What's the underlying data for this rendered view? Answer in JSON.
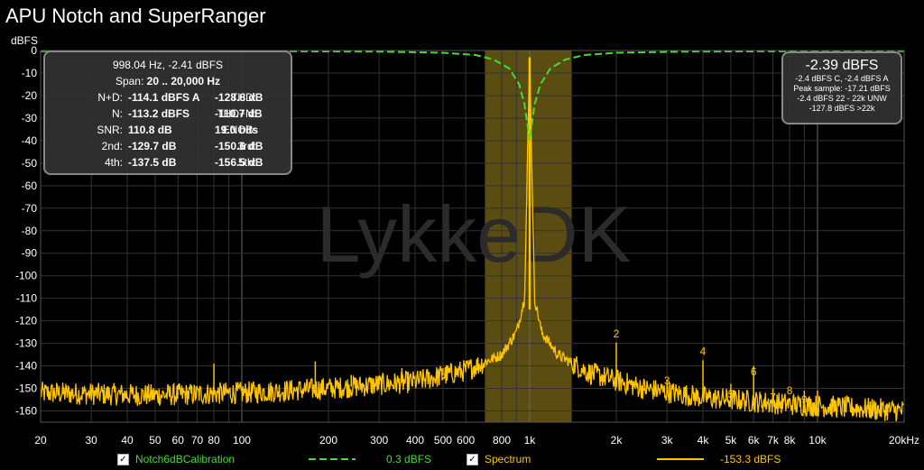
{
  "title": "APU Notch and SuperRanger",
  "measurements": {
    "header1": "998.04 Hz, -2.41 dBFS",
    "header2_label": "Span: ",
    "header2_value": "20 .. 20,000 Hz",
    "rows": [
      {
        "l_label": "N+D:",
        "l_value": "-114.1 dBFS A",
        "r_label": "THD:",
        "r_value": "-128.8 dB"
      },
      {
        "l_label": "N:",
        "l_value": "-113.2 dBFS",
        "r_label": "THD+N:",
        "r_value": "-110.7 dB"
      },
      {
        "l_label": "SNR:",
        "l_value": "110.8 dB",
        "r_label": "ENOB:",
        "r_value": "19.0 bits"
      },
      {
        "l_label": "2nd:",
        "l_value": "-129.7 dB",
        "r_label": "3rd:",
        "r_value": "-150.6 dB"
      },
      {
        "l_label": "4th:",
        "l_value": "-137.5 dB",
        "r_label": "5th:",
        "r_value": "-156.5 dB"
      }
    ]
  },
  "level_box": {
    "main": "-2.39 dBFS",
    "lines": [
      "-2.4 dBFS C, -2.4 dBFS A",
      "Peak sample: -17.21 dBFS",
      "-2.4 dBFS 22 - 22k UNW",
      "-127.8 dBFS >22k"
    ]
  },
  "watermark": "LykkeDK",
  "legend": {
    "items": [
      {
        "label": "Notch6dBCalibration",
        "value": "0.3 dBFS",
        "checkbox": "✓"
      },
      {
        "label": "Spectrum",
        "value": "-153.3 dBFS",
        "checkbox": "✓"
      }
    ]
  },
  "colors": {
    "spectrum": "#FFC400",
    "notch": "#44DD33",
    "band": "#6B5A14",
    "grid": "#333333"
  },
  "chart_data": {
    "type": "line",
    "xscale": "log",
    "xlim": [
      20,
      20000
    ],
    "ylim": [
      -165,
      0
    ],
    "ylabel": "dBFS",
    "yticks": [
      0,
      -10,
      -20,
      -30,
      -40,
      -50,
      -60,
      -70,
      -80,
      -90,
      -100,
      -110,
      -120,
      -130,
      -140,
      -150,
      -160
    ],
    "xticks": [
      {
        "v": 20,
        "l": "20"
      },
      {
        "v": 30,
        "l": "30"
      },
      {
        "v": 40,
        "l": "40"
      },
      {
        "v": 50,
        "l": "50"
      },
      {
        "v": 60,
        "l": "60"
      },
      {
        "v": 70,
        "l": "70"
      },
      {
        "v": 80,
        "l": "80"
      },
      {
        "v": 100,
        "l": "100"
      },
      {
        "v": 200,
        "l": "200"
      },
      {
        "v": 300,
        "l": "300"
      },
      {
        "v": 400,
        "l": "400"
      },
      {
        "v": 500,
        "l": "500"
      },
      {
        "v": 600,
        "l": "600"
      },
      {
        "v": 800,
        "l": "800"
      },
      {
        "v": 1000,
        "l": "1k"
      },
      {
        "v": 2000,
        "l": "2k"
      },
      {
        "v": 3000,
        "l": "3k"
      },
      {
        "v": 4000,
        "l": "4k"
      },
      {
        "v": 5000,
        "l": "5k"
      },
      {
        "v": 6000,
        "l": "6k"
      },
      {
        "v": 7000,
        "l": "7k"
      },
      {
        "v": 8000,
        "l": "8k"
      },
      {
        "v": 10000,
        "l": "10k"
      },
      {
        "v": 20000,
        "l": "20kHz"
      }
    ],
    "band": [
      700,
      1400
    ],
    "series": [
      {
        "name": "Notch6dBCalibration",
        "style": "dashed",
        "points": [
          [
            20,
            -0.3
          ],
          [
            100,
            -0.3
          ],
          [
            300,
            -0.5
          ],
          [
            500,
            -1
          ],
          [
            650,
            -2
          ],
          [
            750,
            -4
          ],
          [
            850,
            -8
          ],
          [
            920,
            -15
          ],
          [
            960,
            -24
          ],
          [
            990,
            -36
          ],
          [
            1000,
            -40
          ],
          [
            1010,
            -36
          ],
          [
            1040,
            -24
          ],
          [
            1090,
            -15
          ],
          [
            1180,
            -8
          ],
          [
            1330,
            -4
          ],
          [
            1550,
            -2
          ],
          [
            2000,
            -1
          ],
          [
            3500,
            -0.5
          ],
          [
            10000,
            -0.3
          ],
          [
            20000,
            -0.3
          ]
        ]
      },
      {
        "name": "Spectrum",
        "style": "solid",
        "baseline": [
          [
            20,
            -152
          ],
          [
            50,
            -153
          ],
          [
            100,
            -152
          ],
          [
            200,
            -150
          ],
          [
            400,
            -147
          ],
          [
            600,
            -142
          ],
          [
            800,
            -135
          ],
          [
            900,
            -125
          ],
          [
            960,
            -110
          ],
          [
            1000,
            -3
          ],
          [
            1040,
            -110
          ],
          [
            1100,
            -125
          ],
          [
            1250,
            -135
          ],
          [
            1600,
            -143
          ],
          [
            2500,
            -150
          ],
          [
            4000,
            -154
          ],
          [
            8000,
            -157
          ],
          [
            20000,
            -160
          ]
        ],
        "spurs": [
          [
            60,
            -152
          ],
          [
            80,
            -139
          ],
          [
            180,
            -138
          ],
          [
            240,
            -144
          ],
          [
            300,
            -145
          ],
          [
            360,
            -141
          ],
          [
            500,
            -141
          ],
          [
            2000,
            -129.7
          ],
          [
            2500,
            -151
          ],
          [
            3000,
            -146
          ],
          [
            4000,
            -137.5
          ],
          [
            5000,
            -148
          ],
          [
            6000,
            -140
          ],
          [
            7000,
            -150
          ],
          [
            9000,
            -151
          ],
          [
            10000,
            -151
          ]
        ]
      }
    ],
    "harmonics": [
      {
        "label": "2",
        "f": 2000,
        "db": -129.7
      },
      {
        "label": "3",
        "f": 3000,
        "db": -150.6
      },
      {
        "label": "4",
        "f": 4000,
        "db": -137.5
      },
      {
        "label": "5",
        "f": 5000,
        "db": -156.5
      },
      {
        "label": "6",
        "f": 6000,
        "db": -146.5
      },
      {
        "label": "7",
        "f": 7000,
        "db": -158
      },
      {
        "label": "8",
        "f": 8000,
        "db": -155
      },
      {
        "label": "9",
        "f": 9000,
        "db": -159
      }
    ]
  }
}
